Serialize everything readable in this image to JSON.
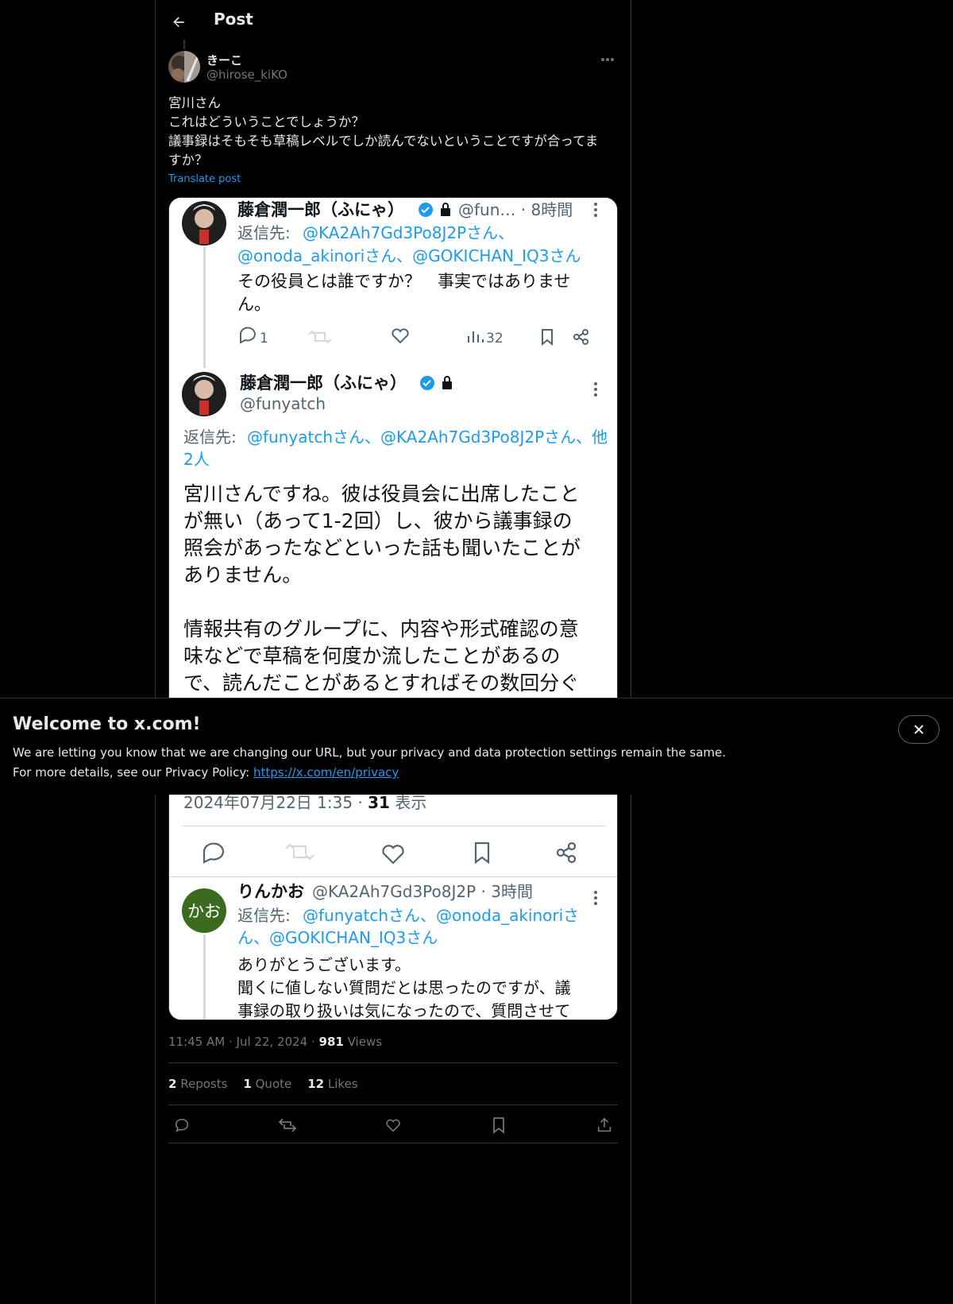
{
  "header": {
    "title": "Post"
  },
  "post": {
    "author_name": "きーこ",
    "author_handle": "@hirose_kiKO",
    "text": "宮川さん\nこれはどういうことでしょうか？\n議事録はそもそも草稿レベルでしか読んでないということですが合ってま\nすか？",
    "translate_label": "Translate post",
    "time": "11:45 AM",
    "date": "Jul 22, 2024",
    "views_count": "981",
    "views_label": "Views",
    "reposts_count": "2",
    "reposts_label": "Reposts",
    "quotes_count": "1",
    "quotes_label": "Quote",
    "likes_count": "12",
    "likes_label": "Likes"
  },
  "screenshot": {
    "tweet1": {
      "name": "藤倉潤一郎（ふにゃ）",
      "handle_time": "@fun… · 8時間",
      "reply_label": "返信先:",
      "reply_line1": "@KA2Ah7Gd3Po8J2Pさん、",
      "reply_line2": "@onoda_akinoriさん、@GOKICHAN_IQ3さん",
      "text_line1": "その役員とは誰ですか？　事実ではありませ",
      "text_line2": "ん。",
      "reply_count": "1",
      "view_count": "32"
    },
    "tweet2": {
      "name": "藤倉潤一郎（ふにゃ）",
      "handle": "@funyatch",
      "reply_label": "返信先:",
      "reply_line1": "@funyatchさん、@KA2Ah7Gd3Po8J2Pさん、他",
      "reply_line2": "2人",
      "text_line1": "宮川さんですね。彼は役員会に出席したこと",
      "text_line2": "が無い（あって1-2回）し、彼から議事録の",
      "text_line3": "照会があったなどといった話も聞いたことが",
      "text_line4": "ありません。",
      "text_line5": "情報共有のグループに、内容や形式確認の意",
      "text_line6": "味などで草稿を何度か流したことがあるの",
      "text_line7": "で、読んだことがあるとすればその数回分ぐ",
      "timestamp": "2024年07月22日 1:35 · ",
      "views": "31",
      "views_suffix": " 表示"
    },
    "tweet3": {
      "avatar_text": "かお",
      "name": "りんかお",
      "handle_time": "@KA2Ah7Gd3Po8J2P · 3時間",
      "reply_label": "返信先:",
      "reply_line1": "@funyatchさん、@onoda_akinoriさ",
      "reply_line2": "ん、@GOKICHAN_IQ3さん",
      "text_line1": "ありがとうございます。",
      "text_line2": "聞くに値しない質問だとは思ったのですが、議",
      "text_line3": "事録の取り扱いは気になったので、質問させて"
    }
  },
  "banner": {
    "title": "Welcome to x.com!",
    "line1": "We are letting you know that we are changing our URL, but your privacy and data protection settings remain the same.",
    "line2": "For more details, see our Privacy Policy: ",
    "link": "https://x.com/en/privacy"
  },
  "colors": {
    "background": "#000000",
    "link_blue": "#1d9bf0",
    "muted": "#71767b",
    "screenshot_link": "#1d9bf0",
    "avatar_green": "#3a6b1e"
  },
  "icons": {
    "back": "arrow-left-icon",
    "more": "more-horizontal-icon",
    "reply": "reply-icon",
    "repost": "repost-icon",
    "like": "heart-icon",
    "bookmark": "bookmark-icon",
    "share": "share-icon",
    "close": "close-icon"
  }
}
